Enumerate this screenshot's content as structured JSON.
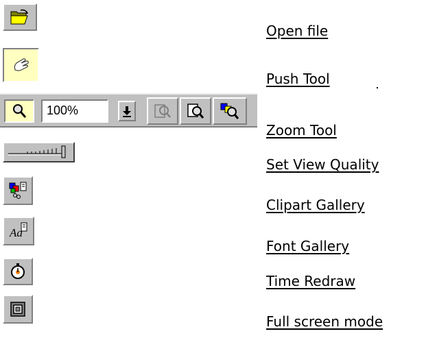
{
  "links": {
    "open_file": "Open file",
    "push_tool": "Push Tool",
    "zoom_tool": "Zoom Tool",
    "set_view_quality": "Set View Quality",
    "clipart_gallery": "Clipart Gallery",
    "font_gallery": "Font Gallery",
    "time_redraw": "Time Redraw",
    "full_screen_mode": "Full screen mode"
  },
  "zoom_toolbar": {
    "zoom_value": "100%"
  },
  "icons": {
    "open_file": "folder-open-icon",
    "push_tool": "hand-icon",
    "zoom_tool": "magnifier-icon",
    "zoom_dropdown": "arrow-down-icon",
    "zoom_previous": "zoom-previous-icon",
    "zoom_page": "zoom-page-icon",
    "zoom_selection": "zoom-selection-icon",
    "set_view_quality": "quality-slider-icon",
    "clipart_gallery": "clipart-gallery-icon",
    "font_gallery": "font-gallery-icon",
    "time_redraw": "stopwatch-icon",
    "full_screen_mode": "full-screen-icon"
  },
  "colors": {
    "button_face": "#c0c0c0",
    "pressed_face": "#ffffc0",
    "link_text": "#000000"
  }
}
